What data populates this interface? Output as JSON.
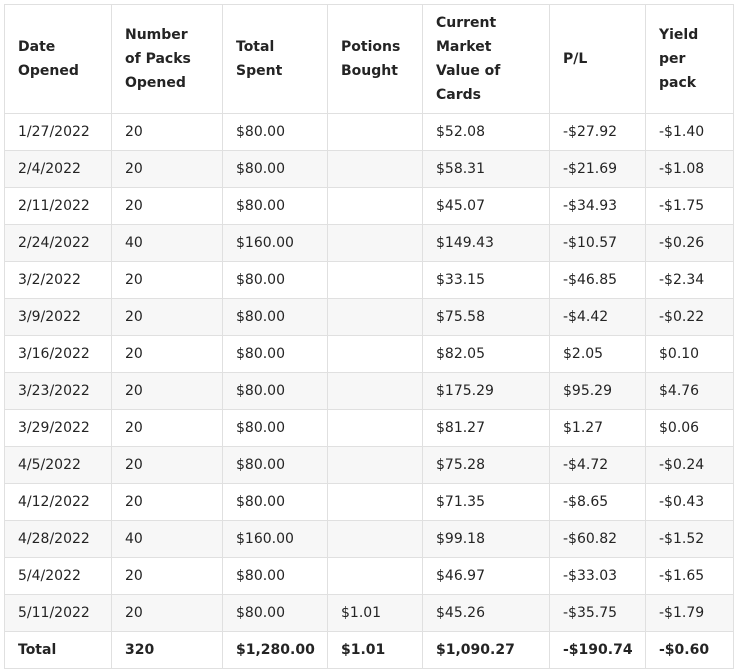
{
  "table": {
    "headers": [
      {
        "lines": [
          "Date",
          "Opened"
        ]
      },
      {
        "lines": [
          "Number",
          "of Packs",
          "Opened"
        ]
      },
      {
        "lines": [
          "Total",
          "Spent"
        ]
      },
      {
        "lines": [
          "Potions",
          "Bought"
        ]
      },
      {
        "lines": [
          "Current",
          "Market",
          "Value of",
          "Cards"
        ]
      },
      {
        "lines": [
          "P/L"
        ]
      },
      {
        "lines": [
          "Yield",
          "per",
          "pack"
        ]
      }
    ],
    "rows": [
      [
        "1/27/2022",
        "20",
        "$80.00",
        "",
        "$52.08",
        "-$27.92",
        "-$1.40"
      ],
      [
        "2/4/2022",
        "20",
        "$80.00",
        "",
        "$58.31",
        "-$21.69",
        "-$1.08"
      ],
      [
        "2/11/2022",
        "20",
        "$80.00",
        "",
        "$45.07",
        "-$34.93",
        "-$1.75"
      ],
      [
        "2/24/2022",
        "40",
        "$160.00",
        "",
        "$149.43",
        "-$10.57",
        "-$0.26"
      ],
      [
        "3/2/2022",
        "20",
        "$80.00",
        "",
        "$33.15",
        "-$46.85",
        "-$2.34"
      ],
      [
        "3/9/2022",
        "20",
        "$80.00",
        "",
        "$75.58",
        "-$4.42",
        "-$0.22"
      ],
      [
        "3/16/2022",
        "20",
        "$80.00",
        "",
        "$82.05",
        "$2.05",
        "$0.10"
      ],
      [
        "3/23/2022",
        "20",
        "$80.00",
        "",
        "$175.29",
        "$95.29",
        "$4.76"
      ],
      [
        "3/29/2022",
        "20",
        "$80.00",
        "",
        "$81.27",
        "$1.27",
        "$0.06"
      ],
      [
        "4/5/2022",
        "20",
        "$80.00",
        "",
        "$75.28",
        "-$4.72",
        "-$0.24"
      ],
      [
        "4/12/2022",
        "20",
        "$80.00",
        "",
        "$71.35",
        "-$8.65",
        "-$0.43"
      ],
      [
        "4/28/2022",
        "40",
        "$160.00",
        "",
        "$99.18",
        "-$60.82",
        "-$1.52"
      ],
      [
        "5/4/2022",
        "20",
        "$80.00",
        "",
        "$46.97",
        "-$33.03",
        "-$1.65"
      ],
      [
        "5/11/2022",
        "20",
        "$80.00",
        "$1.01",
        "$45.26",
        "-$35.75",
        "-$1.79"
      ]
    ],
    "total": [
      "Total",
      "320",
      "$1,280.00",
      "$1.01",
      "$1,090.27",
      "-$190.74",
      "-$0.60"
    ]
  }
}
